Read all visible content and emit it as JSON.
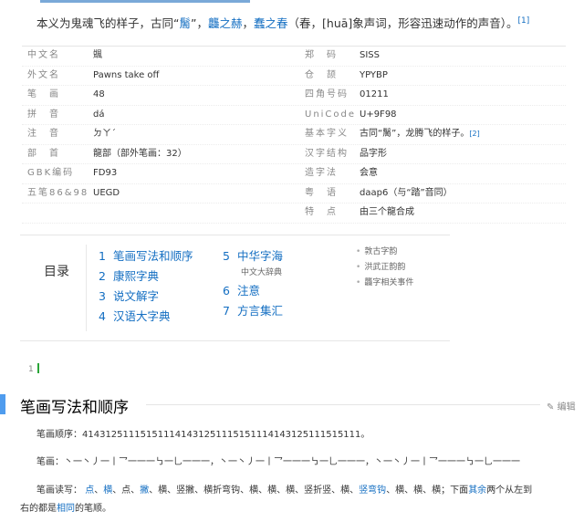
{
  "intro": {
    "prefix": "本义为鬼魂飞的样子，古同“",
    "link1": "䯾",
    "mid1": "”，",
    "link2": "龘之赫",
    "mid2": "，",
    "link3": "蠢之春",
    "suffix": "（春，[huā]象声词，形容迅速动作的声音）。",
    "ref": "[1]"
  },
  "info": {
    "left": [
      {
        "k": "中文名",
        "v": "䬇"
      },
      {
        "k": "外文名",
        "v": "Pawns take off"
      },
      {
        "k": "笔　画",
        "v": "48"
      },
      {
        "k": "拼　音",
        "v": "dá"
      },
      {
        "k": "注　音",
        "v": "ㄉㄚˊ"
      },
      {
        "k": "部　首",
        "v": "龍部（部外笔画：32）"
      },
      {
        "k": "GBK编码",
        "v": "FD93"
      },
      {
        "k": "五笔86&98",
        "v": "UEGD"
      },
      {
        "k": "",
        "v": ""
      }
    ],
    "right": [
      {
        "k": "郑　码",
        "v": "SISS"
      },
      {
        "k": "仓　颉",
        "v": "YPYBP"
      },
      {
        "k": "四角号码",
        "v": "01211"
      },
      {
        "k": "UniCode",
        "v": "U+9F98"
      },
      {
        "k": "基本字义",
        "v": "古同“䯾”，龙腾飞的样子。",
        "ref": "[2]"
      },
      {
        "k": "汉字结构",
        "v": "品字形"
      },
      {
        "k": "造字法",
        "v": "会意"
      },
      {
        "k": "粤　语",
        "v": "daap6（与“踏”音同）"
      },
      {
        "k": "特　点",
        "v": "由三个龍合成"
      }
    ]
  },
  "toc": {
    "title": "目录",
    "col1": [
      {
        "num": "1",
        "label": "笔画写法和顺序"
      },
      {
        "num": "2",
        "label": "康熙字典"
      },
      {
        "num": "3",
        "label": "说文解字"
      },
      {
        "num": "4",
        "label": "汉语大字典"
      }
    ],
    "col2": [
      {
        "num": "5",
        "label": "中华字海"
      },
      {
        "sub": "中文大辞典"
      },
      {
        "num": "6",
        "label": "注意"
      },
      {
        "num": "7",
        "label": "方言集汇"
      }
    ],
    "col3": [
      "敦古字韵",
      "洪武正韵韵",
      "龘字相关事件"
    ]
  },
  "line_num": "1",
  "section": {
    "title": "笔画写法和顺序",
    "edit": "编辑",
    "order_label": "笔画顺序：",
    "order_value": "414312511151511141431251115151114143125111515111。",
    "strokes_label": "笔画：",
    "strokes_value": "丶一丶丿一丨乛一一一㇉一乚一一一，丶一丶丿一丨乛一一一㇉一乚一一一，丶一丶丿一丨乛一一一㇉一乚一一一",
    "read_label": "笔画读写：",
    "read_parts": [
      {
        "t": "点",
        "b": true
      },
      {
        "t": "、"
      },
      {
        "t": "横",
        "b": true
      },
      {
        "t": "、点、"
      },
      {
        "t": "撇",
        "b": true
      },
      {
        "t": "、横、竖撇、横折弯钩、横、横、横、竖折竖、横、"
      },
      {
        "t": "竖弯钩",
        "b": true
      },
      {
        "t": "、横、横、横；下面"
      },
      {
        "t": "其余",
        "b": true
      },
      {
        "t": "两个从左到"
      }
    ],
    "read_line2_a": "右的都是",
    "read_line2_link": "相同",
    "read_line2_b": "的笔顺。"
  }
}
